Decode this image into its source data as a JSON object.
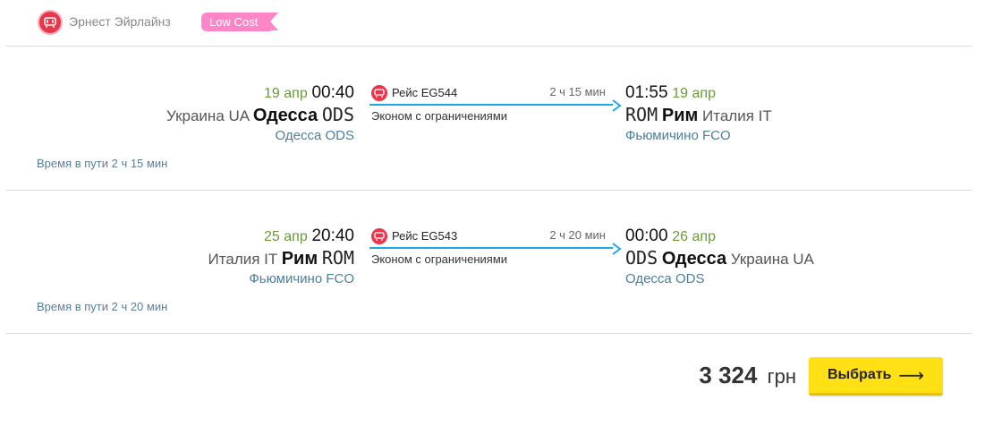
{
  "airline": {
    "name": "Эрнест Эйрлайнз",
    "badge": "Low Cost",
    "brand_color": "#e8364a",
    "badge_color": "#ff85c8"
  },
  "segments": [
    {
      "departure": {
        "date": "19 апр",
        "time": "00:40",
        "country": "Украина UA",
        "city": "Одесса",
        "code": "ODS",
        "airport": "Одесса ODS"
      },
      "flight": {
        "number": "Рейс EG544",
        "duration": "2 ч 15 мин",
        "fare_class": "Эконом с ограничениями"
      },
      "arrival": {
        "time": "01:55",
        "date": "19 апр",
        "code": "ROM",
        "city": "Рим",
        "country": "Италия IT",
        "airport": "Фьюмичино FCO"
      },
      "travel_time": "Время в пути 2 ч 15 мин"
    },
    {
      "departure": {
        "date": "25 апр",
        "time": "20:40",
        "country": "Италия IT",
        "city": "Рим",
        "code": "ROM",
        "airport": "Фьюмичино FCO"
      },
      "flight": {
        "number": "Рейс EG543",
        "duration": "2 ч 20 мин",
        "fare_class": "Эконом с ограничениями"
      },
      "arrival": {
        "time": "00:00",
        "date": "26 апр",
        "code": "ODS",
        "city": "Одесса",
        "country": "Украина UA",
        "airport": "Одесса ODS"
      },
      "travel_time": "Время в пути 2 ч 20 мин"
    }
  ],
  "price": {
    "amount": "3 324",
    "currency": "грн"
  },
  "select_button": {
    "label": "Выбрать",
    "arrow": "⟶",
    "color": "#ffe015"
  },
  "colors": {
    "route_arrow": "#1aaaea",
    "date_green": "#6a9a3a",
    "airport_blue": "#4a7f9a"
  }
}
